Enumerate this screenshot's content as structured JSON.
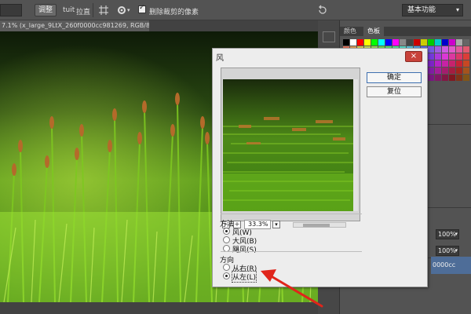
{
  "optionsbar": {
    "refine_button": "调整",
    "auto_label": "tuit",
    "straighten_label": "拉直",
    "delete_cropped_label": "删除裁剪的像素",
    "delete_cropped_checked": true,
    "workspace": "基本功能"
  },
  "document": {
    "tab_title": "7.1% (x_large_9LtX_260f0000cc981269, RGB/8)",
    "tab_suffix": "*",
    "close_glyph": "×"
  },
  "swatches_panel": {
    "tabs": [
      "颜色",
      "色板"
    ],
    "active_tab": "色板"
  },
  "layers_panel": {
    "opacity": "100%",
    "fill": "100%",
    "selected_layer": "0000cc"
  },
  "dialog": {
    "title": "风",
    "close_glyph": "×",
    "ok_button": "确定",
    "reset_button": "复位",
    "zoom_minus": "−",
    "zoom_plus": "+",
    "zoom_value": "33.3%",
    "zoom_dropdown": "▾",
    "method": {
      "label": "方法",
      "options": [
        "风(W)",
        "大风(B)",
        "飓风(S)"
      ],
      "selected": "风(W)"
    },
    "direction": {
      "label": "方向",
      "options": [
        "从右(R)",
        "从左(L)"
      ],
      "selected": "从左(L)"
    }
  },
  "annotation": {
    "arrow_color": "#e0251b"
  }
}
